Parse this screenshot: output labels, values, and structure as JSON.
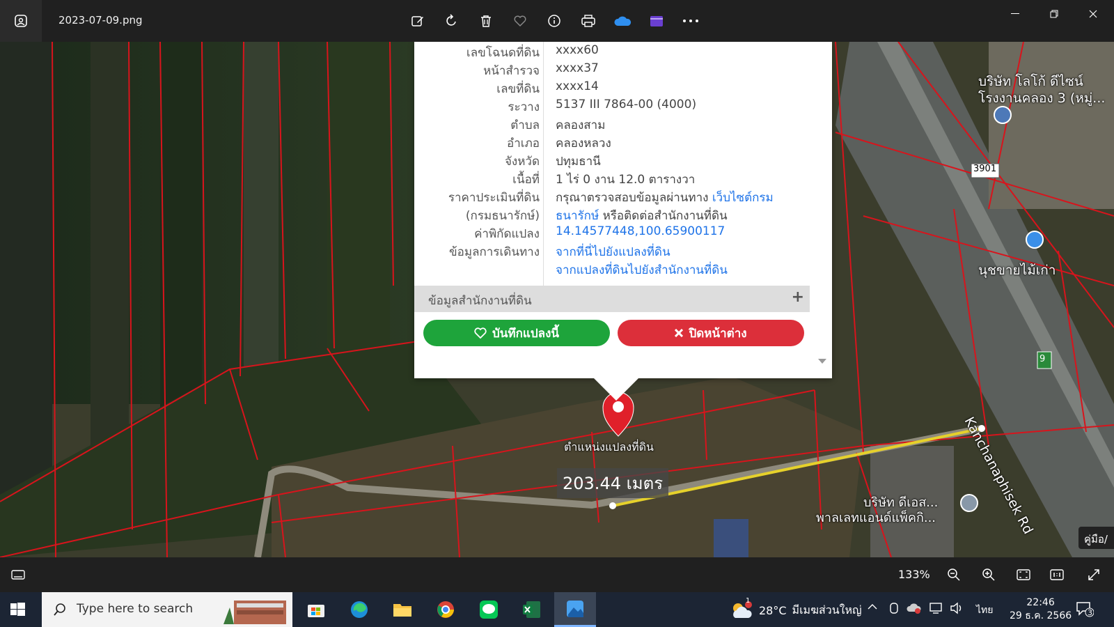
{
  "window": {
    "title": "2023-07-09.png",
    "toolbar_icons": [
      "edit-icon",
      "rotate-icon",
      "delete-icon",
      "favorite-icon",
      "info-icon",
      "print-icon",
      "onedrive-icon",
      "clipchamp-icon",
      "more-icon"
    ]
  },
  "popup": {
    "rows": [
      {
        "label": "เลขโฉนดที่ดิน",
        "value": "xxxx60"
      },
      {
        "label": "หน้าสำรวจ",
        "value": "xxxx37"
      },
      {
        "label": "เลขที่ดิน",
        "value": "xxxx14"
      },
      {
        "label": "ระวาง",
        "value": "5137 III 7864-00 (4000)"
      },
      {
        "label": "ตำบล",
        "value": "คลองสาม"
      },
      {
        "label": "อำเภอ",
        "value": "คลองหลวง"
      },
      {
        "label": "จังหวัด",
        "value": "ปทุมธานี"
      },
      {
        "label": "เนื้อที่",
        "value": "1 ไร่ 0 งาน 12.0 ตารางวา"
      }
    ],
    "price": {
      "label_1": "ราคาประเมินที่ดิน",
      "label_2": "(กรมธนารักษ์)",
      "text_1": "กรุณาตรวจสอบข้อมูลผ่านทาง ",
      "link_1": "เว็บไซต์กรม",
      "link_2": "ธนารักษ์",
      "text_2": " หรือติดต่อสำนักงานที่ดิน"
    },
    "coords": {
      "label": "ค่าพิกัดแปลง",
      "value": "14.14577448,100.65900117"
    },
    "directions": {
      "label": "ข้อมูลการเดินทาง",
      "link_1": "จากที่นี่ไปยังแปลงที่ดิน",
      "link_2": "จากแปลงที่ดินไปยังสำนักงานที่ดิน"
    },
    "office_section": "ข้อมูลสำนักงานที่ดิน",
    "office_expand": "+",
    "save_button": "บันทึกแปลงนี้",
    "close_button": "ปิดหน้าต่าง"
  },
  "map": {
    "pin_label": "ตำแหน่งแปลงที่ดิน",
    "distance": "203.44 เมตร",
    "company_top": "บริษัท โลโก้ ดีไซน์",
    "company_top_2": "โรงงานคลอง 3 (หมู่...",
    "road_number": "3901",
    "shop": "นุชขายไม้เก่า",
    "road_name": "Kanchanaphisek Rd",
    "company_bottom": "บริษัท ดีเอส...",
    "company_bottom_2": "พาลเลทแอนด์แพ็คกิ...",
    "route_badge": "9",
    "guide_tab": "คู่มือ/"
  },
  "statusbar": {
    "zoom": "133%"
  },
  "taskbar": {
    "search_placeholder": "Type here to search",
    "weather_temp": "28°C",
    "weather_text": "มีเมฆส่วนใหญ่",
    "language": "ไทย",
    "time": "22:46",
    "date": "29 ธ.ค. 2566",
    "notifications": "3",
    "weather_badge": "1"
  }
}
